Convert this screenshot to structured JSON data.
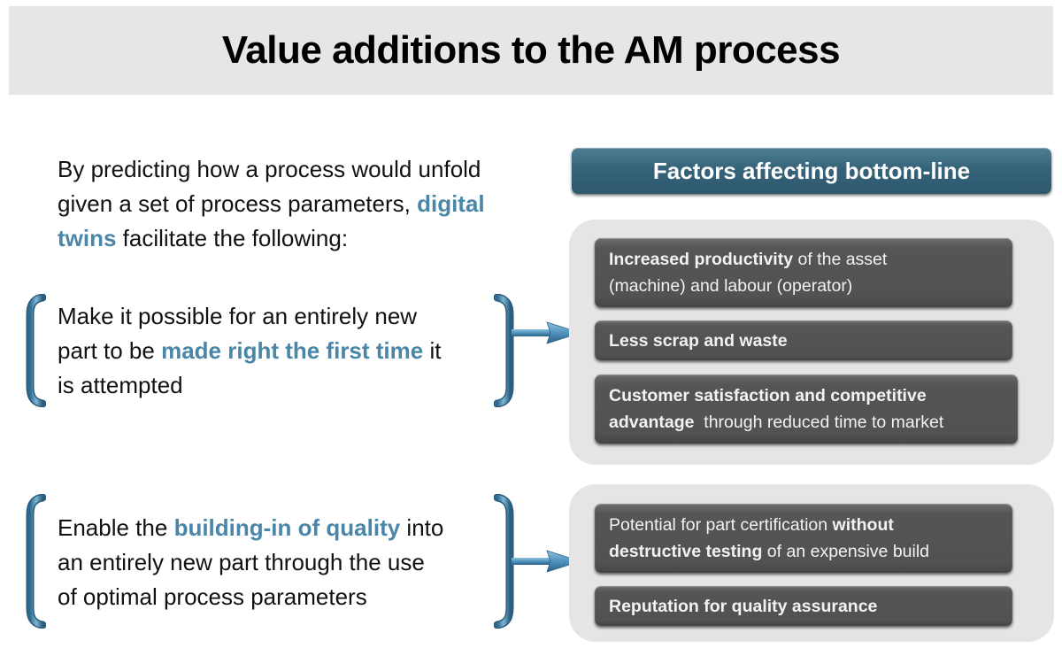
{
  "title": "Value additions to the AM process",
  "intro": {
    "line1": "By predicting how a process would unfold",
    "line2_pre": "given a set of process parameters, ",
    "line2_hl": "digital",
    "line3_hl": "twins",
    "line3_post": " facilitate the following:"
  },
  "groups": [
    {
      "line1": "Make it possible for an entirely new",
      "line2_pre": "part to be ",
      "line2_hl": "made right the first time",
      "line2_post": " it",
      "line3": "is attempted"
    },
    {
      "line1_pre": "Enable the ",
      "line1_hl": "building-in of quality",
      "line1_post": " into",
      "line2": "an entirely new part through the use",
      "line3": "of optimal process parameters"
    }
  ],
  "factors_header": "Factors affecting bottom-line",
  "factors": {
    "productivity": {
      "bold": "Increased productivity",
      "rest1": " of the asset",
      "line2": "(machine) and labour (operator)"
    },
    "scrap": {
      "bold": "Less scrap and waste"
    },
    "customer": {
      "bold1": "Customer satisfaction and competitive",
      "bold2": "advantage",
      "rest2": "  through reduced time to market"
    },
    "certification": {
      "pre1": "Potential for part certification ",
      "bold1": "without",
      "bold2": "destructive testing",
      "rest2": " of an expensive build"
    },
    "reputation": {
      "bold": "Reputation for quality assurance"
    }
  },
  "colors": {
    "highlight": "#4a86a8",
    "header_bar": "#35637a",
    "factor_box": "#555555",
    "panel": "#e5e5e5",
    "title_bar": "#e6e6e6"
  }
}
